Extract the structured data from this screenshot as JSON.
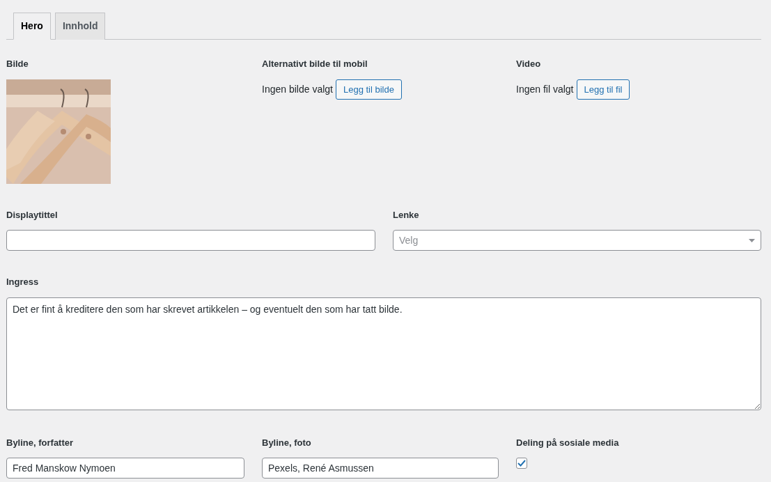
{
  "tabs": [
    {
      "label": "Hero",
      "selected": true
    },
    {
      "label": "Innhold",
      "selected": false
    }
  ],
  "media": [
    {
      "label": "Bilde"
    },
    {
      "kind": "empty",
      "label": "Alternativt bilde til mobil",
      "status": "Ingen bilde valgt",
      "button": "Legg til bilde"
    },
    {
      "kind": "empty",
      "label": "Video",
      "status": "Ingen fil valgt",
      "button": "Legg til fil"
    }
  ],
  "display_title": {
    "label": "Displaytittel"
  },
  "link": {
    "label": "Lenke",
    "placeholder": "Velg"
  },
  "ingress": {
    "label": "Ingress",
    "value": "Det er fint å kreditere den som har skrevet artikkelen – og eventuelt den som har tatt bilde."
  },
  "byline_author": {
    "label": "Byline, forfatter",
    "value": "Fred Manskow Nymoen"
  },
  "byline_photo": {
    "label": "Byline, foto",
    "value": "Pexels, René Asmussen"
  },
  "social_sharing": {
    "label": "Deling på sosiale media",
    "checked": true
  }
}
